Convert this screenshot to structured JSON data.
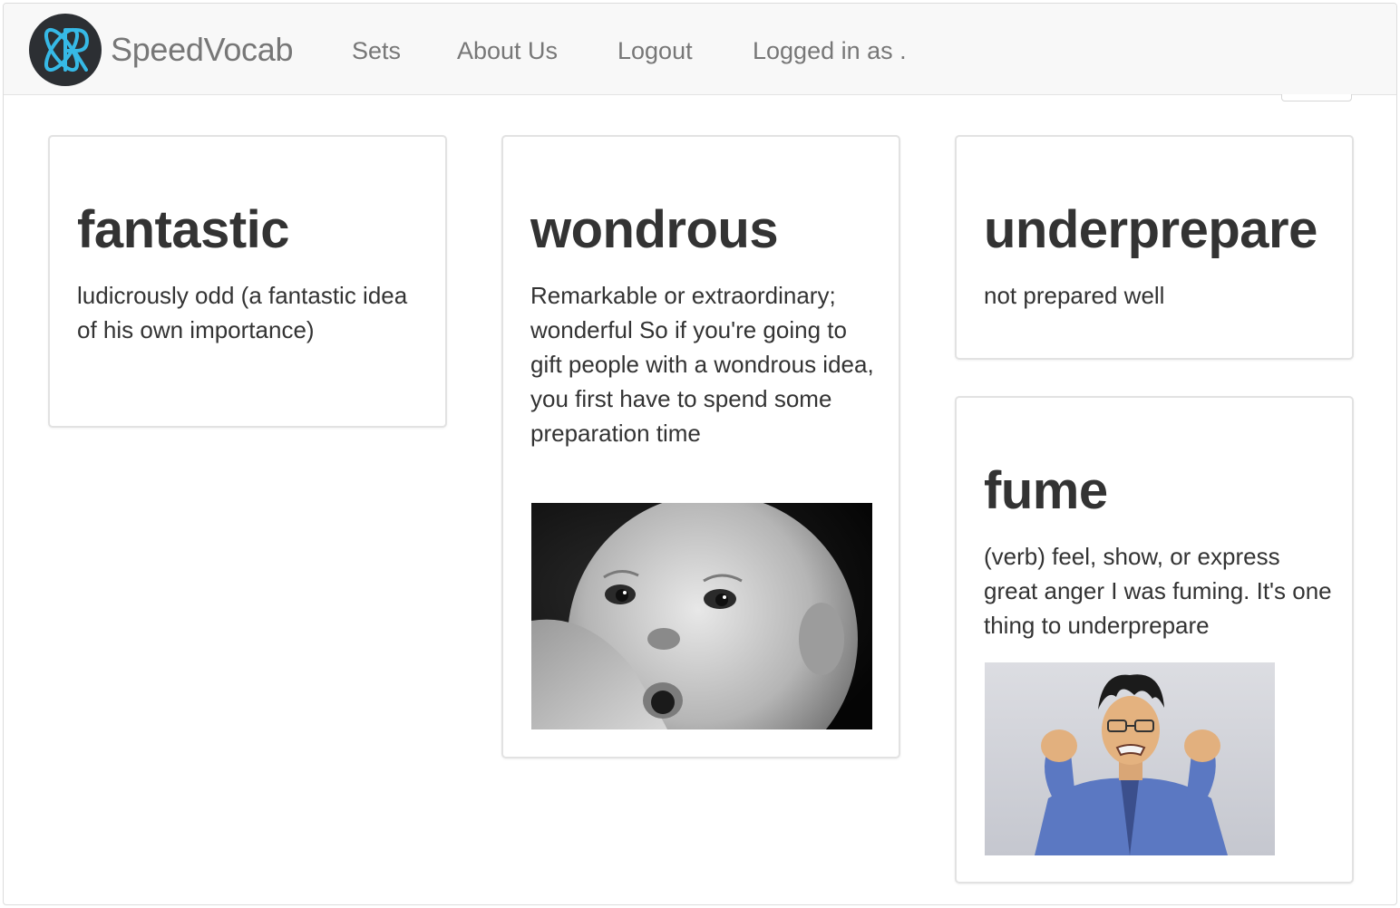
{
  "navbar": {
    "brand": "SpeedVocab",
    "links": [
      {
        "label": "Sets"
      },
      {
        "label": "About Us"
      },
      {
        "label": "Logout"
      },
      {
        "label": "Logged in as ."
      }
    ]
  },
  "colors": {
    "navbar_bg": "#f8f8f8",
    "nav_text": "#777777",
    "logo_bg": "#2c2f33",
    "logo_accent": "#36b9e6",
    "card_border": "#e2e2e2",
    "text": "#333333"
  },
  "cards": [
    {
      "word": "fantastic",
      "definition": "ludicrously odd (a fantastic idea of his own importance)"
    },
    {
      "word": "wondrous",
      "definition": "Remarkable or extraordinary; wonderful So if you're going to gift people with a wondrous idea, you first have to spend some preparation time",
      "image": "surprised-baby-photo"
    },
    {
      "word": "underprepare",
      "definition": "not prepared well"
    },
    {
      "word": "fume",
      "definition": "(verb) feel, show, or express great anger I was fuming. It's one thing to underprepare",
      "image": "angry-man-photo"
    }
  ]
}
